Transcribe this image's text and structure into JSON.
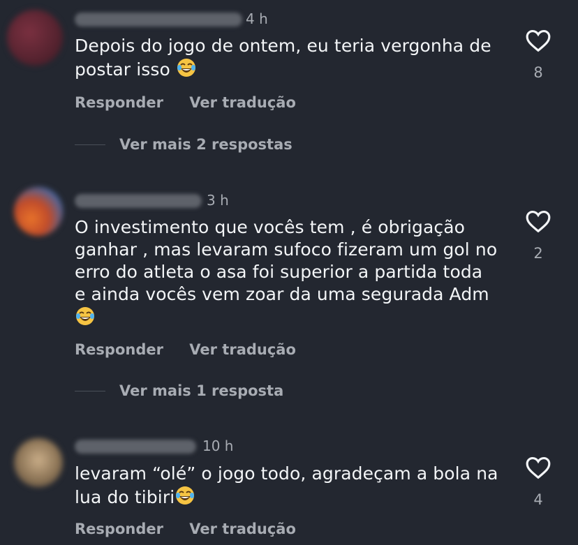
{
  "comments": [
    {
      "time": "4 h",
      "text_lines": [
        "Depois do jogo de ontem, eu teria vergonha de",
        "postar isso"
      ],
      "likes": "8",
      "reply_label": "Responder",
      "translate_label": "Ver tradução",
      "more_replies": "Ver mais 2 respostas",
      "avatar_colors": [
        "#6e2a3a",
        "#4a1f2a"
      ]
    },
    {
      "time": "3 h",
      "text_lines": [
        "O investimento que vocês tem , é obrigação",
        "ganhar , mas levaram sufoco fizeram um gol no",
        "erro do atleta  o asa foi superior a partida toda",
        "e ainda vocês vem zoar  da uma segurada Adm"
      ],
      "likes": "2",
      "reply_label": "Responder",
      "translate_label": "Ver tradução",
      "more_replies": "Ver mais 1 resposta",
      "avatar_colors": [
        "#e06a2a",
        "#3a6bb0"
      ]
    },
    {
      "time": "10 h",
      "text_lines": [
        "levaram “olé” o jogo todo, agradeçam a bola na",
        "lua do tibiri"
      ],
      "likes": "4",
      "reply_label": "Responder",
      "translate_label": "Ver tradução",
      "avatar_colors": [
        "#b59a78",
        "#5b4a3a"
      ]
    }
  ],
  "icons": {
    "like": "heart-icon",
    "emoji": "face-with-tears-of-joy"
  },
  "colors": {
    "background": "#232730",
    "primary_text": "#f3f5f7",
    "secondary_text": "#a8acb3"
  }
}
